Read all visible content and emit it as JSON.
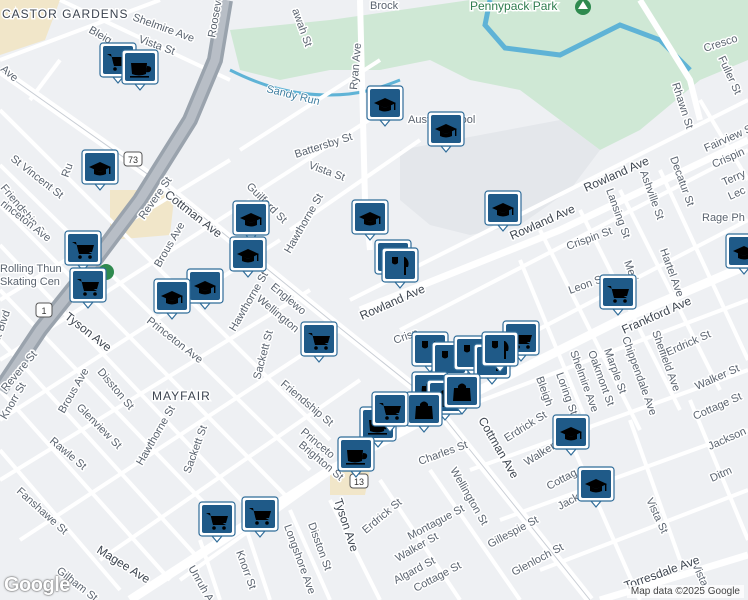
{
  "map": {
    "colors": {
      "background": "#eef0f3",
      "road": "#ffffff",
      "highway": "#9aa3ad",
      "park": "#cfe8d5",
      "water": "#5fb3d6",
      "poi_pin": "#1f5a88"
    },
    "area_labels": [
      "CASTOR GARDENS",
      "MAYFAIR"
    ],
    "park_label": "Pennypack Park",
    "water_label": "Sandy Run",
    "school_label": "Austin School",
    "business_label": "Rage Ph",
    "shield_labels": [
      "73",
      "1",
      "13"
    ],
    "rink_label_line1": "Rolling Thun",
    "rink_label_line2": "Skating Cen",
    "streets": {
      "shelmire_ave_top": "Shelmire Ave",
      "vista_st_top": "Vista St",
      "blei": "Bleig",
      "roosevelt": "Roosevelt",
      "brockton": "Brock",
      "rawah": "awah St",
      "ryan_ave": "Ryan Ave",
      "cresco": "Cresco",
      "fuller": "Fuller St",
      "rhawn": "Rhawn St",
      "battersby": "Battersby St",
      "vista_st_mid": "Vista St",
      "st_vincent": "St Vincent St",
      "friendship_top": "Friendship St",
      "princeton_top": "rinceton Ave",
      "ave_topleft": "Ave",
      "revere_top": "Revere St",
      "brous_top": "Brous Ave",
      "cottman_top": "Cottman Ave",
      "guilford": "Guilford St",
      "hawthorne_mid": "Hawthorne St",
      "hawthorne_left": "Hawthorne St",
      "englewood": "Englewo",
      "wellington_mid": "Wellington",
      "princeton_mid": "Princeton Ave",
      "tyson_left": "Tyson Ave",
      "revere_left": "Revere St",
      "knorr_left": "Knorr St",
      "disston_left": "Disston St",
      "brous_left": "Brous Ave",
      "glenview": "Glenview St",
      "rawle": "Rawle St",
      "hawthorne_low": "Hawthorne St",
      "sackett_low": "Sackett St",
      "sackett_mid": "Sackett St",
      "fanshawe": "Fanshawe St",
      "friendship_mid": "Friendship St",
      "princeton_low": "Princeto",
      "brighton": "Brighton St",
      "magee": "Magee Ave",
      "gilham": "Gilham St",
      "unruh": "Unruh A",
      "knorr_low": "Knorr St",
      "longshore": "Longshore Ave",
      "disston_low": "Disston St",
      "tyson_low": "Tyson Ave",
      "erdrick_low": "Erdrick St",
      "montague": "Montague St",
      "walker_low": "Walker St",
      "algard": "Algard St",
      "cottage_low": "Cottage St",
      "wellington_low": "Wellington St",
      "charles": "Charles St",
      "gillespie": "Gillespie St",
      "glenloch": "Glenloch St",
      "cottman_low": "Cottman Ave",
      "erdrick_mid": "Erdrick St",
      "walker_mid": "Walker St",
      "cottage_mid": "Cottag",
      "jackson_mid": "Jackson St",
      "vista_low": "Vista St",
      "vista_lowright": "Vista",
      "torresdale": "Torresdale Ave",
      "frankford": "Frankford Ave",
      "leon": "Leon St",
      "crispin_mid": "Crispin St",
      "crispin_low": "Crisp",
      "rowland_ave": "Rowland Ave",
      "rowland_ave_mid": "Rowland Ave",
      "rowland_ave_right": "Rowland Ave",
      "lansing": "Lansing St",
      "ashville": "Ashville St",
      "decatur": "Decatur St",
      "hartel": "Hartel Ave",
      "meri": "Meri",
      "sheffield": "Sheffield Ave",
      "chippendale": "Chippendale Ave",
      "marple": "Marple St",
      "oakmont": "Oakmont St",
      "shelmire_low": "Shelmire Ave",
      "loring": "Loring St",
      "bleigh": "Bleigh",
      "erdrick_right": "Erdrick St",
      "walker_right": "Walker St",
      "cottage_right": "Cottage St",
      "jackson_right": "Jackson",
      "ditm": "Ditm",
      "fairview": "Fairview St",
      "crispin_right": "Crispin",
      "terry": "Terry",
      "lec": "Lec",
      "ru": "Ru",
      "lt_blvd": "lt Blvd"
    }
  },
  "attribution": "Map data ©2025 Google",
  "logo": "Google"
}
